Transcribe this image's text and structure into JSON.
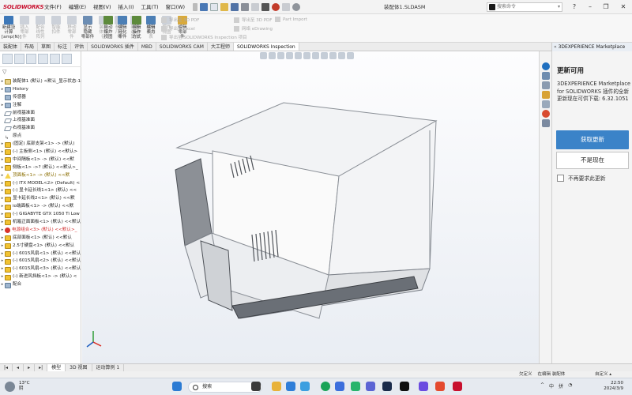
{
  "app": {
    "brand": "SOLIDWORKS",
    "document_title": "装配体1.SLDASM",
    "menus": [
      "文件(F)",
      "编辑(E)",
      "视图(V)",
      "插入(I)",
      "工具(T)",
      "窗口(W)"
    ],
    "search_placeholder": "搜索命令",
    "search_arrow": "▾"
  },
  "command_manager": {
    "buttons": [
      {
        "label": "新建设\n计算\n[amp(N)]",
        "disabled": false
      },
      {
        "label": "插入\n零部\n件",
        "disabled": true
      },
      {
        "label": "配合\n线性\n阵列",
        "disabled": true
      },
      {
        "label": "智能\n扣件",
        "disabled": true
      },
      {
        "label": "移动\n零部\n件",
        "disabled": true
      },
      {
        "label": "显示\n隐藏\n零部件",
        "disabled": false
      },
      {
        "label": "装配\n体特\n征",
        "disabled": true
      },
      {
        "label": "参考\n几何\n体",
        "disabled": true
      },
      {
        "label": "新建\n运动\n算例",
        "disabled": true
      },
      {
        "label": "材料\n明细\n表",
        "disabled": true
      },
      {
        "label": "爆炸\n视图",
        "disabled": true
      },
      {
        "label": "编辑\n零部\n件",
        "disabled": false
      },
      {
        "label": "自动\n爆炸\n视图",
        "disabled": false
      },
      {
        "label": "编辑\n轻化\n零件",
        "disabled": false
      },
      {
        "label": "编辑\n操作\n方式",
        "disabled": false
      },
      {
        "label": "编辑\n表力",
        "disabled": false
      }
    ],
    "disabled_rows": [
      "导出至 3D PDF",
      "导出至 Excel",
      "导出至 SOLIDWORKS Inspection 项目",
      "导出至 3D PDF",
      "网络 eDrawing",
      "Part Import"
    ]
  },
  "tabs": [
    "装配体",
    "布局",
    "草图",
    "标注",
    "评估",
    "SOLIDWORKS 插件",
    "MBD",
    "SOLIDWORKS CAM",
    "大工程师",
    "SOLIDWORKS Inspection"
  ],
  "active_tab": "SOLIDWORKS Inspection",
  "right_panel_title": "3DEXPERIENCE Marketplace",
  "feature_tree": {
    "filter_icon": "▽",
    "nodes": [
      {
        "exp": "▸",
        "icon": "asm",
        "label": "装配体1 (默认) <默认_显示状态-1>"
      },
      {
        "exp": "▸",
        "icon": "folder",
        "label": "History"
      },
      {
        "exp": "",
        "icon": "folder",
        "label": "传感器"
      },
      {
        "exp": "▸",
        "icon": "folder",
        "label": "注解"
      },
      {
        "exp": "",
        "icon": "plane",
        "label": "前视基准面"
      },
      {
        "exp": "",
        "icon": "plane",
        "label": "上视基准面"
      },
      {
        "exp": "",
        "icon": "plane",
        "label": "右视基准面"
      },
      {
        "exp": "",
        "icon": "origin",
        "label": "原点"
      },
      {
        "exp": "▸",
        "icon": "part",
        "label": "(固定) 底部支架<1> -> (默认)"
      },
      {
        "exp": "▸",
        "icon": "part",
        "label": "(-) 主板侧<1> (默认) <<默认>"
      },
      {
        "exp": "▸",
        "icon": "part",
        "label": "中间隔板<1> -> (默认) <<默"
      },
      {
        "exp": "▸",
        "icon": "part",
        "label": "侧板<1> ->? (默认) <<默认>_"
      },
      {
        "exp": "▸",
        "icon": "warn",
        "label": "顶面板<1> -> (默认) <<默",
        "cls": "warntext"
      },
      {
        "exp": "▸",
        "icon": "part",
        "label": "(-) ITX MODEL<2> (Default) <"
      },
      {
        "exp": "▸",
        "icon": "part",
        "label": "(-) 显卡延长线1<1> (默认) <<"
      },
      {
        "exp": "▸",
        "icon": "part",
        "label": "显卡延长线2<1> (默认) <<默"
      },
      {
        "exp": "▸",
        "icon": "part",
        "label": "io端面板<1> -> (默认) <<默"
      },
      {
        "exp": "▸",
        "icon": "part",
        "label": "(-) GIGABYTE GTX 1050 Ti Low"
      },
      {
        "exp": "▸",
        "icon": "part",
        "label": "机箱正面面板<1> (默认) <<默认"
      },
      {
        "exp": "▸",
        "icon": "err",
        "label": "电源组合<3> (默认) <<默认>_",
        "cls": "errtext"
      },
      {
        "exp": "▸",
        "icon": "part",
        "label": "底部面板<1> (默认) <<默认"
      },
      {
        "exp": "▸",
        "icon": "part",
        "label": "2.5寸硬盘<1> (默认) <<默认"
      },
      {
        "exp": "▸",
        "icon": "part",
        "label": "(-) 6015风扇<1> (默认) <<默认"
      },
      {
        "exp": "▸",
        "icon": "part",
        "label": "(-) 6015风扇<2> (默认) <<默认"
      },
      {
        "exp": "▸",
        "icon": "part",
        "label": "(-) 6015风扇<3> (默认) <<默认"
      },
      {
        "exp": "▸",
        "icon": "part",
        "label": "(-) 新进风挡板<1> -> (默认) <"
      },
      {
        "exp": "▸",
        "icon": "folder",
        "label": "配合"
      }
    ]
  },
  "bottom_tabs": [
    "模型",
    "3D 视图",
    "运动算例 1"
  ],
  "active_bottom_tab": "模型",
  "status_bar": {
    "left": "",
    "view": "欠定义",
    "mode": "在编辑 装配体",
    "units": "自定义"
  },
  "task_pane": {
    "title": "更新可用",
    "message": "3DEXPERIENCE Marketplace for SOLIDWORKS 插件的全新更新现在可供下载: 6.32.1051",
    "primary_button": "获取更新",
    "secondary_button": "不是现在",
    "checkbox_label": "不再要求此更新"
  },
  "taskbar": {
    "weather_temp": "13°C",
    "weather_desc": "阴",
    "search_label": "搜索",
    "tray_lang": "中",
    "tray_ime": "拼",
    "time": "22:50",
    "date": "2024/3/9"
  }
}
